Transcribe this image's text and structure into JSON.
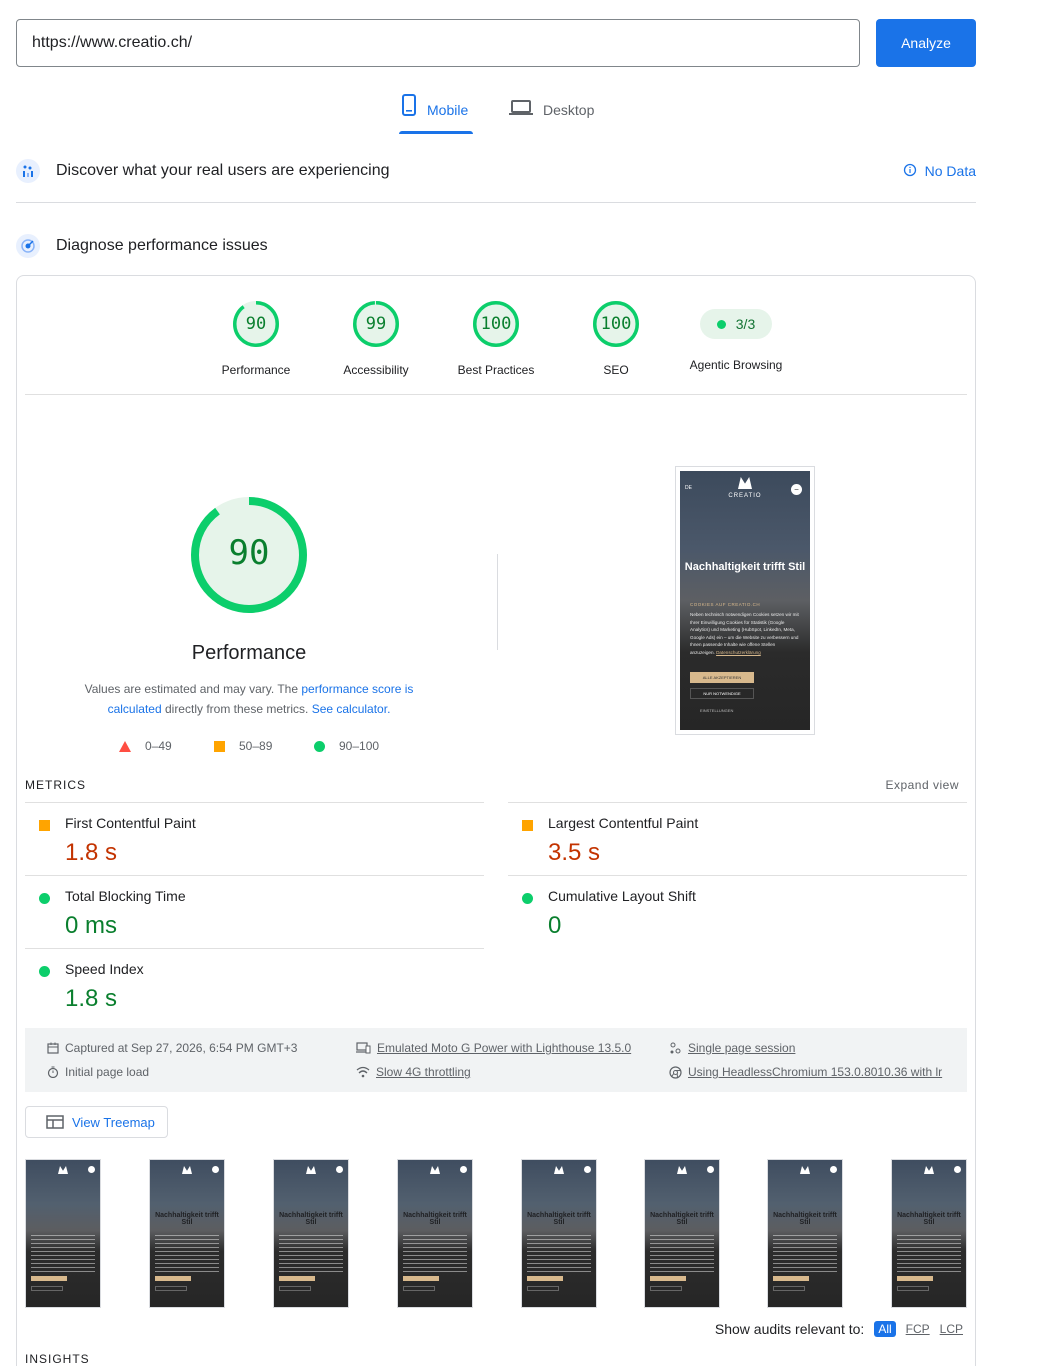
{
  "url_bar": {
    "value": "https://www.creatio.ch/",
    "analyze_label": "Analyze"
  },
  "tabs": [
    {
      "label": "Mobile",
      "active": true
    },
    {
      "label": "Desktop",
      "active": false
    }
  ],
  "field_data": {
    "title": "Discover what your real users are experiencing",
    "status": "No Data"
  },
  "lab": {
    "title": "Diagnose performance issues"
  },
  "categories": [
    {
      "score": "90",
      "label": "Performance",
      "value": 90
    },
    {
      "score": "99",
      "label": "Accessibility",
      "value": 99
    },
    {
      "score": "100",
      "label": "Best Practices",
      "value": 100
    },
    {
      "score": "100",
      "label": "SEO",
      "value": 100
    }
  ],
  "agentic": {
    "score": "3/3",
    "label": "Agentic Browsing"
  },
  "performance": {
    "score": "90",
    "value": 90,
    "title": "Performance",
    "desc_prefix": "Values are estimated and may vary. The ",
    "link1": "performance score is calculated",
    "desc_mid": " directly from these metrics. ",
    "link2": "See calculator."
  },
  "legend": {
    "fail": "0–49",
    "average": "50–89",
    "pass": "90–100"
  },
  "screenshot": {
    "heading": "Nachhaltigkeit trifft Stil",
    "brand": "CREATIO",
    "lang": "DE",
    "cookie_title": "COOKIES AUF CREATIO.CH",
    "cookie_text": "Neben technisch notwendigen Cookies setzen wir mit Ihrer Einwilligung Cookies für Statistik (Google Analytics) und Marketing (HubSpot, LinkedIn, Meta, Google Ads) ein – um die Website zu verbessern und Ihnen passende Inhalte wie offene Stellen anzuzeigen.",
    "privacy_link": "Datenschutzerklärung",
    "accept_all": "ALLE AKZEPTIEREN",
    "necessary_only": "NUR NOTWENDIGE",
    "settings": "EINSTELLUNGEN"
  },
  "metrics": {
    "section_label": "METRICS",
    "expand": "Expand view",
    "items": [
      {
        "name": "First Contentful Paint",
        "value": "1.8 s",
        "rating": "average"
      },
      {
        "name": "Largest Contentful Paint",
        "value": "3.5 s",
        "rating": "average"
      },
      {
        "name": "Total Blocking Time",
        "value": "0 ms",
        "rating": "pass"
      },
      {
        "name": "Cumulative Layout Shift",
        "value": "0",
        "rating": "pass"
      },
      {
        "name": "Speed Index",
        "value": "1.8 s",
        "rating": "pass"
      }
    ]
  },
  "run_info": {
    "captured": "Captured at Sep 27, 2026, 6:54 PM GMT+3",
    "page_load": "Initial page load",
    "device": "Emulated Moto G Power with Lighthouse 13.5.0",
    "throttling": "Slow 4G throttling",
    "session": "Single page session",
    "browser": "Using HeadlessChromium 153.0.8010.36 with lr"
  },
  "treemap_label": "View Treemap",
  "filmstrip_headings": [
    "",
    "Nachhaltigkeit trifft Stil",
    "Nachhaltigkeit trifft Stil",
    "Nachhaltigkeit trifft Stil",
    "Nachhaltigkeit trifft Stil",
    "Nachhaltigkeit trifft Stil",
    "Nachhaltigkeit trifft Stil",
    "Nachhaltigkeit trifft Stil"
  ],
  "audits_filter": {
    "label": "Show audits relevant to:",
    "all": "All",
    "fcp": "FCP",
    "lcp": "LCP"
  },
  "insights_label": "INSIGHTS",
  "colors": {
    "accent": "#1a73e8",
    "pass": "#0cce6b",
    "average": "#ffa400",
    "fail": "#ff4e42",
    "pass_text": "#0a7f2e",
    "average_text": "#c33300"
  }
}
